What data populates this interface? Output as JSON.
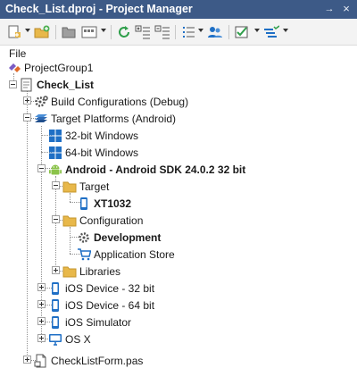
{
  "window": {
    "title": "Check_List.dproj - Project Manager",
    "pin_glyph": "→",
    "close_glyph": "×"
  },
  "menu": {
    "file_label": "File"
  },
  "toolbar": {
    "icons": [
      "new-item-icon",
      "add-icon",
      "folder-icon",
      "view-icon",
      "refresh-icon",
      "expand-icon",
      "collapse-icon",
      "list-icon",
      "people-icon",
      "checklist-icon",
      "sort-icon"
    ]
  },
  "tree": {
    "project_group": "ProjectGroup1",
    "project": "Check_List",
    "build_configurations": "Build Configurations (Debug)",
    "target_platforms": "Target Platforms (Android)",
    "win32": "32-bit Windows",
    "win64": "64-bit Windows",
    "android": "Android - Android SDK 24.0.2 32 bit",
    "target": "Target",
    "device": "XT1032",
    "configuration": "Configuration",
    "development": "Development",
    "app_store": "Application Store",
    "libraries": "Libraries",
    "ios_device_32": "iOS Device - 32 bit",
    "ios_device_64": "iOS Device - 64 bit",
    "ios_simulator": "iOS Simulator",
    "osx": "OS X",
    "form_file": "CheckListForm.pas"
  },
  "colors": {
    "titlebar": "#3d5a87",
    "windows_blue": "#1f6fc5",
    "android_green": "#8bc34a",
    "folder_yellow": "#e8b84a"
  }
}
